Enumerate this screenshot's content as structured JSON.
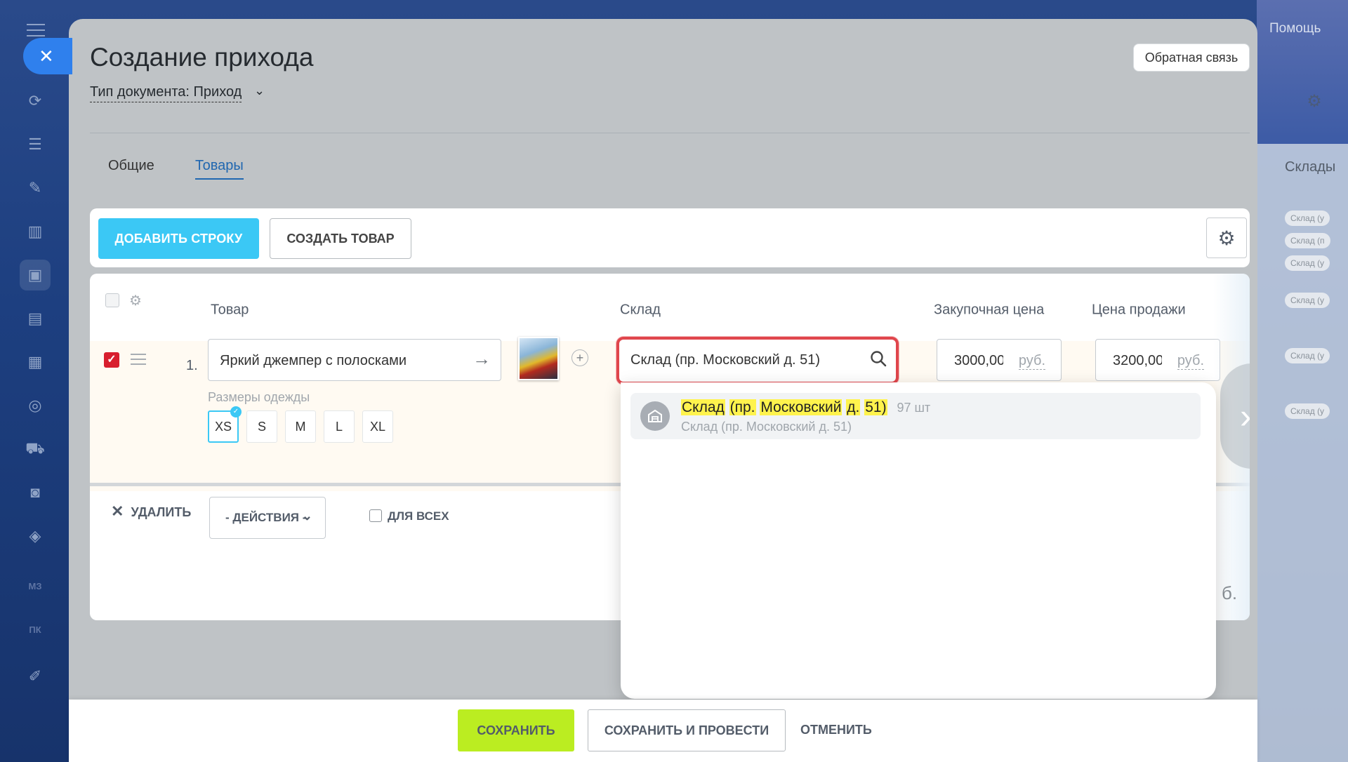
{
  "app": {
    "help_label": "Помощь",
    "feedback_label": "Обратная связь"
  },
  "header": {
    "title": "Создание прихода",
    "doc_type_label": "Тип документа: Приход"
  },
  "tabs": [
    {
      "label": "Общие",
      "active": false
    },
    {
      "label": "Товары",
      "active": true
    }
  ],
  "toolbar": {
    "add_row_label": "ДОБАВИТЬ СТРОКУ",
    "create_product_label": "СОЗДАТЬ ТОВАР"
  },
  "table": {
    "columns": {
      "product": "Товар",
      "stock": "Склад",
      "purchase_price": "Закупочная цена",
      "sale_price": "Цена продажи"
    },
    "rows": [
      {
        "num": "1.",
        "checked": true,
        "product_name": "Яркий джемпер с полосками",
        "sizes_label": "Размеры одежды",
        "sizes": [
          "XS",
          "S",
          "M",
          "L",
          "XL"
        ],
        "selected_size": "XS",
        "stock_value": "Склад (пр. Московский д. 51)",
        "purchase_price": "3000,00",
        "purchase_currency": "руб.",
        "sale_price": "3200,00",
        "sale_currency": "руб."
      }
    ],
    "partial_total_fragment": "б."
  },
  "footer_actions": {
    "delete_label": "УДАЛИТЬ",
    "actions_label": "- ДЕЙСТВИЯ -",
    "for_all_label": "ДЛЯ ВСЕХ"
  },
  "stock_dropdown": {
    "items": [
      {
        "title_parts": [
          "Склад",
          "(пр.",
          "Московский",
          "д.",
          "51)"
        ],
        "quantity": "97 шт",
        "subtitle": "Склад (пр. Московский д. 51)"
      }
    ]
  },
  "background_panel": {
    "title": "Склады",
    "chips": [
      "Склад (у",
      "Склад (п",
      "Склад (у",
      "Склад (у",
      "Склад (у",
      "Склад (у"
    ]
  },
  "sidebar": {
    "text_items": [
      "МЗ",
      "ПК"
    ]
  },
  "bottom_bar": {
    "save_label": "СОХРАНИТЬ",
    "save_post_label": "СОХРАНИТЬ И ПРОВЕСТИ",
    "cancel_label": "ОТМЕНИТЬ"
  }
}
